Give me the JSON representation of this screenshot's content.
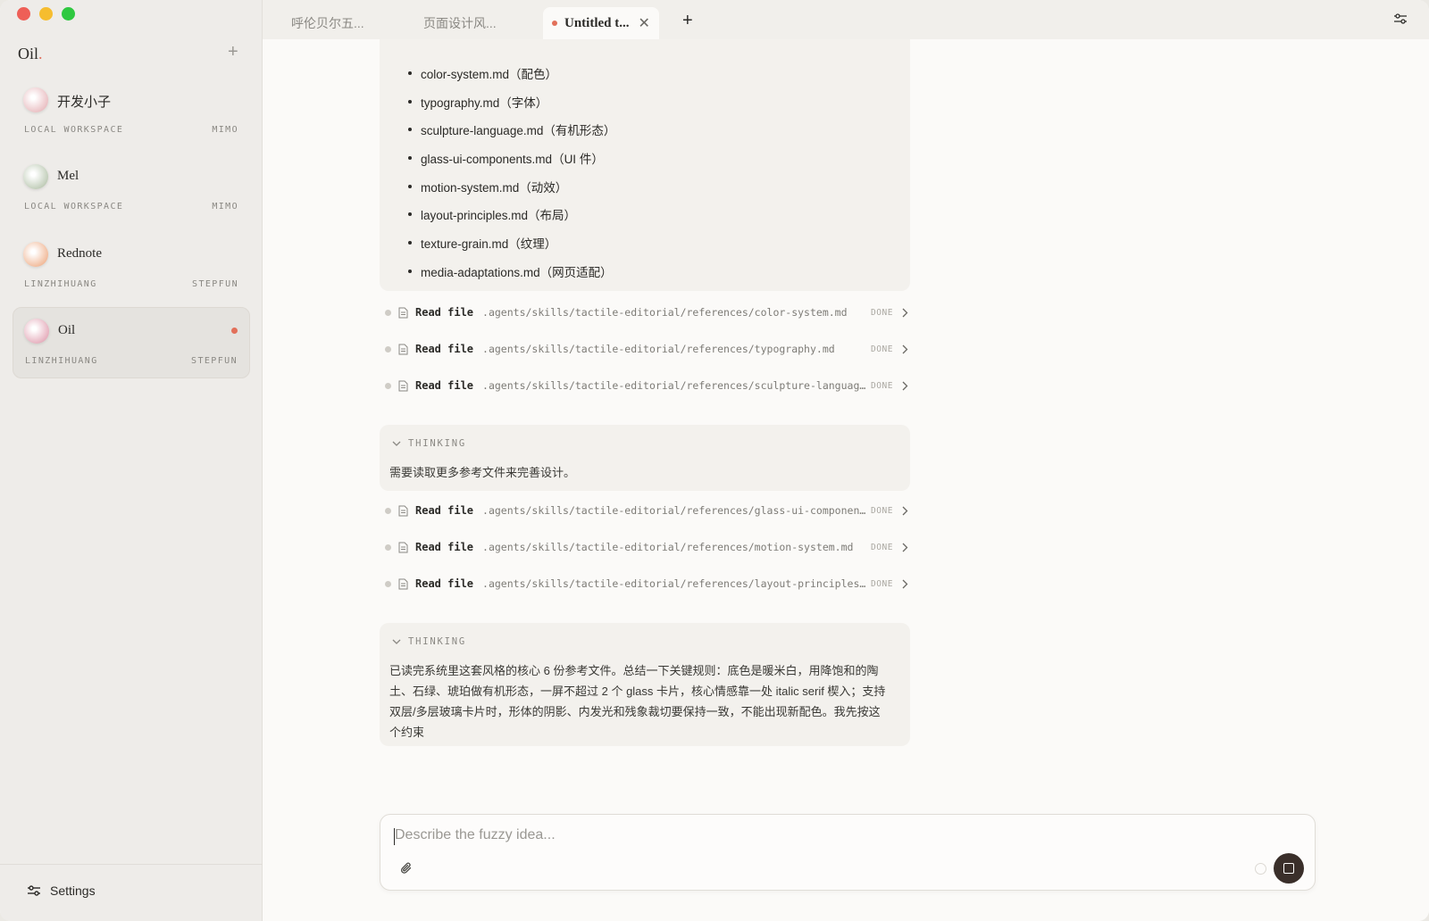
{
  "sidebar": {
    "brand": "Oil",
    "brand_dot": ".",
    "add_label": "+",
    "workspaces": [
      {
        "name": "开发小子",
        "owner": "LOCAL WORKSPACE",
        "model": "MIMO",
        "avatar_color": "#e8b9bd"
      },
      {
        "name": "Mel",
        "owner": "LOCAL WORKSPACE",
        "model": "MIMO",
        "avatar_color": "#b9c7b0"
      },
      {
        "name": "Rednote",
        "owner": "LINZHIHUANG",
        "model": "STEPFUN",
        "avatar_color": "#f0b38f"
      },
      {
        "name": "Oil",
        "owner": "LINZHIHUANG",
        "model": "STEPFUN",
        "avatar_color": "#e3a6b6"
      }
    ],
    "settings_label": "Settings"
  },
  "tabs": [
    {
      "label": "呼伦贝尔五..."
    },
    {
      "label": "页面设计风..."
    },
    {
      "label": "Untitled t...",
      "close": "✕"
    }
  ],
  "tab_add": "+",
  "main": {
    "files": [
      "color-system.md（配色）",
      "typography.md（字体）",
      "sculpture-language.md（有机形态）",
      "glass-ui-components.md（UI 件）",
      "motion-system.md（动效）",
      "layout-principles.md（布局）",
      "texture-grain.md（纹理）",
      "media-adaptations.md（网页适配）"
    ],
    "tool_calls_1": [
      {
        "verb": "Read file",
        "path": ".agents/skills/tactile-editorial/references/color-system.md",
        "status": "DONE"
      },
      {
        "verb": "Read file",
        "path": ".agents/skills/tactile-editorial/references/typography.md",
        "status": "DONE"
      },
      {
        "verb": "Read file",
        "path": ".agents/skills/tactile-editorial/references/sculpture-language.md",
        "status": "DONE"
      }
    ],
    "thinking_1": {
      "label": "THINKING",
      "text": "需要读取更多参考文件来完善设计。"
    },
    "tool_calls_2": [
      {
        "verb": "Read file",
        "path": ".agents/skills/tactile-editorial/references/glass-ui-components.md",
        "status": "DONE"
      },
      {
        "verb": "Read file",
        "path": ".agents/skills/tactile-editorial/references/motion-system.md",
        "status": "DONE"
      },
      {
        "verb": "Read file",
        "path": ".agents/skills/tactile-editorial/references/layout-principles.md",
        "status": "DONE"
      }
    ],
    "thinking_2": {
      "label": "THINKING",
      "text": "已读完系统里这套风格的核心 6 份参考文件。总结一下关键规则：底色是暖米白，用降饱和的陶土、石绿、琥珀做有机形态，一屏不超过 2 个 glass 卡片，核心情感靠一处 italic serif 楔入；支持双层/多层玻璃卡片时，形体的阴影、内发光和残象裁切要保持一致，不能出现新配色。我先按这个约束"
    }
  },
  "composer": {
    "placeholder": "Describe the fuzzy idea..."
  },
  "colors": {
    "accent": "#e2705a",
    "background": "#fbfaf8",
    "sidebar": "#eeece9",
    "stop_button": "#3a2f2a"
  }
}
